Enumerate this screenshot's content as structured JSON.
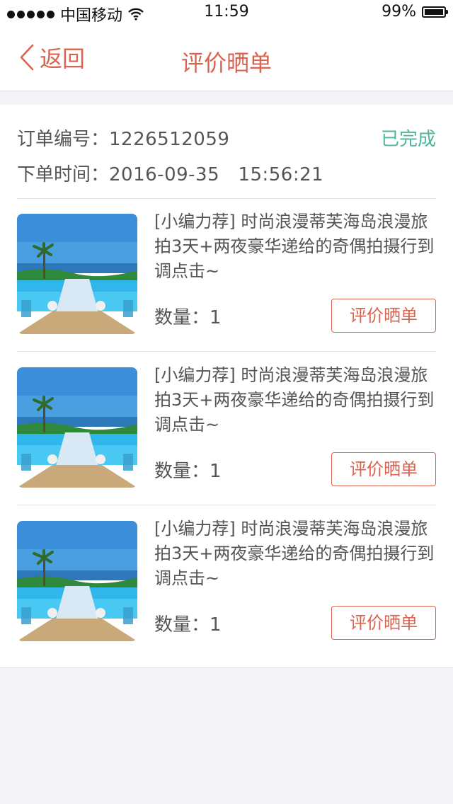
{
  "status_bar": {
    "carrier": "中国移动",
    "time": "11:59",
    "battery": "99%"
  },
  "nav": {
    "back_label": "返回",
    "title": "评价晒单"
  },
  "order": {
    "number_label": "订单编号：",
    "number_value": "1226512059",
    "time_label": "下单时间：",
    "time_value": "2016-09-35   15:56:21",
    "status": "已完成"
  },
  "items": [
    {
      "title": "[小编力荐] 时尚浪漫蒂芙海岛浪漫旅拍3天+两夜豪华递给的奇偶拍摄行到调点击~",
      "qty_label": "数量：",
      "qty_value": "1",
      "button_label": "评价晒单"
    },
    {
      "title": "[小编力荐] 时尚浪漫蒂芙海岛浪漫旅拍3天+两夜豪华递给的奇偶拍摄行到调点击~",
      "qty_label": "数量：",
      "qty_value": "1",
      "button_label": "评价晒单"
    },
    {
      "title": "[小编力荐] 时尚浪漫蒂芙海岛浪漫旅拍3天+两夜豪华递给的奇偶拍摄行到调点击~",
      "qty_label": "数量：",
      "qty_value": "1",
      "button_label": "评价晒单"
    }
  ],
  "colors": {
    "accent": "#d9644f",
    "status_done": "#4fb59a",
    "page_bg": "#f4f4f8"
  },
  "icons": [
    "signal-dots-icon",
    "wifi-icon",
    "battery-icon",
    "chevron-left-icon"
  ]
}
